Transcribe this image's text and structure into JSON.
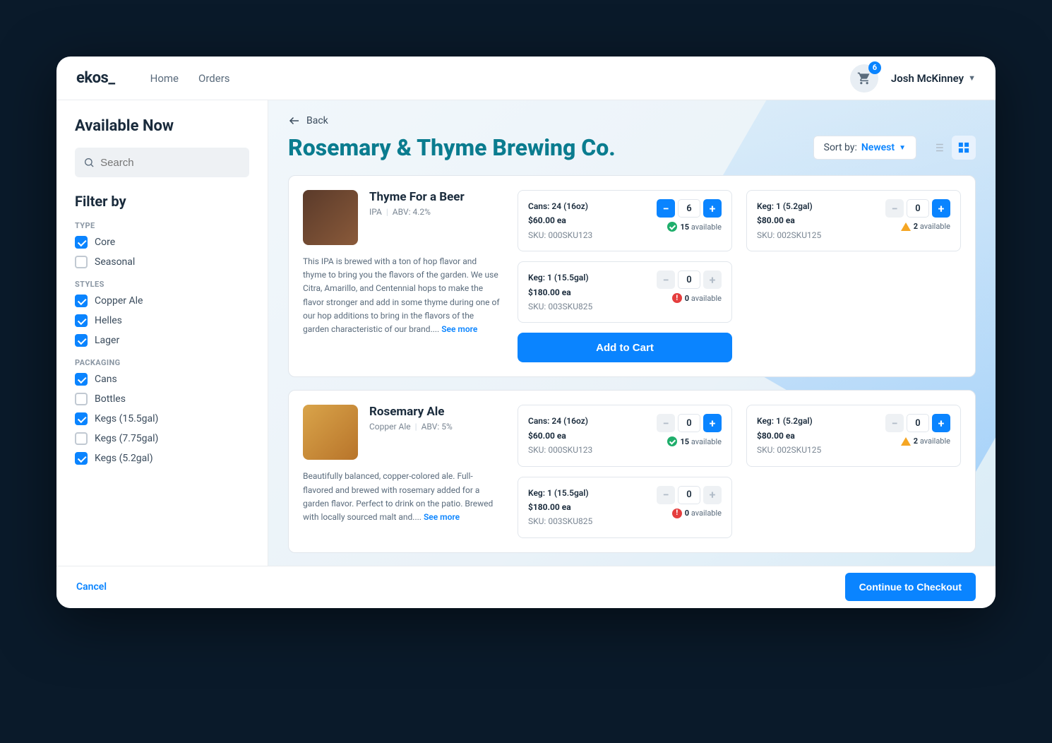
{
  "brand": "ekos_",
  "nav": {
    "home": "Home",
    "orders": "Orders"
  },
  "cart_count": "6",
  "user_name": "Josh McKinney",
  "sidebar": {
    "title": "Available Now",
    "search_placeholder": "Search",
    "filter_title": "Filter by",
    "groups": {
      "type": {
        "label": "TYPE",
        "items": [
          {
            "label": "Core",
            "checked": true
          },
          {
            "label": "Seasonal",
            "checked": false
          }
        ]
      },
      "styles": {
        "label": "STYLES",
        "items": [
          {
            "label": "Copper Ale",
            "checked": true
          },
          {
            "label": "Helles",
            "checked": true
          },
          {
            "label": "Lager",
            "checked": true
          }
        ]
      },
      "packaging": {
        "label": "PACKAGING",
        "items": [
          {
            "label": "Cans",
            "checked": true
          },
          {
            "label": "Bottles",
            "checked": false
          },
          {
            "label": "Kegs (15.5gal)",
            "checked": true
          },
          {
            "label": "Kegs (7.75gal)",
            "checked": false
          },
          {
            "label": "Kegs (5.2gal)",
            "checked": true
          }
        ]
      }
    }
  },
  "main": {
    "back_label": "Back",
    "page_title": "Rosemary & Thyme Brewing Co.",
    "sort_label": "Sort by:",
    "sort_value": "Newest",
    "add_to_cart": "Add to Cart",
    "see_more": "See more"
  },
  "products": [
    {
      "name": "Thyme For a Beer",
      "style": "IPA",
      "abv": "ABV: 4.2%",
      "desc": "This IPA is brewed with a ton of hop flavor and thyme to bring you the flavors of the garden. We use Citra, Amarillo, and Centennial hops to make the flavor stronger and add in some thyme during one of our hop additions to bring in the flavors of the garden characteristic of our brand.... ",
      "variants": [
        {
          "title": "Cans: 24 (16oz)",
          "price": "$60.00 ea",
          "sku": "SKU: 000SKU123",
          "qty": "6",
          "avail_count": "15",
          "avail_text": " available",
          "status": "ok",
          "minus": "active",
          "plus": "active"
        },
        {
          "title": "Keg: 1 (5.2gal)",
          "price": "$80.00 ea",
          "sku": "SKU: 002SKU125",
          "qty": "0",
          "avail_count": "2",
          "avail_text": " available",
          "status": "warn",
          "minus": "disabled",
          "plus": "active"
        },
        {
          "title": "Keg: 1 (15.5gal)",
          "price": "$180.00 ea",
          "sku": "SKU: 003SKU825",
          "qty": "0",
          "avail_count": "0",
          "avail_text": " available",
          "status": "err",
          "minus": "disabled",
          "plus": "disabled"
        }
      ]
    },
    {
      "name": "Rosemary Ale",
      "style": "Copper Ale",
      "abv": "ABV: 5%",
      "desc": "Beautifully balanced, copper-colored ale. Full-flavored and brewed with rosemary added for a garden flavor. Perfect to drink on the patio. Brewed with locally sourced malt and.... ",
      "variants": [
        {
          "title": "Cans: 24 (16oz)",
          "price": "$60.00 ea",
          "sku": "SKU: 000SKU123",
          "qty": "0",
          "avail_count": "15",
          "avail_text": " available",
          "status": "ok",
          "minus": "disabled",
          "plus": "active"
        },
        {
          "title": "Keg: 1 (5.2gal)",
          "price": "$80.00 ea",
          "sku": "SKU: 002SKU125",
          "qty": "0",
          "avail_count": "2",
          "avail_text": " available",
          "status": "warn",
          "minus": "disabled",
          "plus": "active"
        },
        {
          "title": "Keg: 1 (15.5gal)",
          "price": "$180.00 ea",
          "sku": "SKU: 003SKU825",
          "qty": "0",
          "avail_count": "0",
          "avail_text": " available",
          "status": "err",
          "minus": "disabled",
          "plus": "disabled"
        }
      ]
    }
  ],
  "footer": {
    "cancel": "Cancel",
    "checkout": "Continue to Checkout"
  }
}
